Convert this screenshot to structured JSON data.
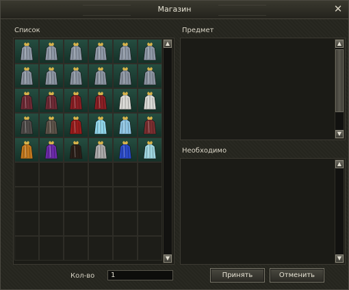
{
  "window": {
    "title": "Магазин",
    "close_glyph": "✕"
  },
  "list": {
    "label": "Список"
  },
  "item_panel": {
    "label": "Предмет"
  },
  "required_panel": {
    "label": "Необходимо"
  },
  "quantity": {
    "label": "Кол-во",
    "value": "1"
  },
  "buttons": {
    "accept": "Принять",
    "cancel": "Отменить"
  },
  "scroll_glyphs": {
    "up": "▲",
    "down": "▼"
  },
  "slots": [
    {
      "icon": "cloak-icon",
      "color": "#8e98a6"
    },
    {
      "icon": "cloak-icon",
      "color": "#8e98a6"
    },
    {
      "icon": "cloak-icon",
      "color": "#8e98a6"
    },
    {
      "icon": "cloak-icon",
      "color": "#8e98a6"
    },
    {
      "icon": "cloak-icon",
      "color": "#8e98a6"
    },
    {
      "icon": "cloak-icon",
      "color": "#8e98a6"
    },
    {
      "icon": "cloak-icon",
      "color": "#8a93a0"
    },
    {
      "icon": "cloak-icon",
      "color": "#8a93a0"
    },
    {
      "icon": "cloak-icon",
      "color": "#8a93a0"
    },
    {
      "icon": "cloak-icon",
      "color": "#8a93a0"
    },
    {
      "icon": "cloak-icon",
      "color": "#8a93a0"
    },
    {
      "icon": "cloak-icon",
      "color": "#8a93a0"
    },
    {
      "icon": "cloak-icon",
      "color": "#6e2a35"
    },
    {
      "icon": "cloak-icon",
      "color": "#6e2a35"
    },
    {
      "icon": "cloak-icon",
      "color": "#8a1f24"
    },
    {
      "icon": "cloak-icon",
      "color": "#8a1f24"
    },
    {
      "icon": "cloak-icon",
      "color": "#d8d8d4"
    },
    {
      "icon": "cloak-icon",
      "color": "#d8d8d4"
    },
    {
      "icon": "cloak-icon",
      "color": "#4e4a48"
    },
    {
      "icon": "cloak-icon",
      "color": "#5c5248"
    },
    {
      "icon": "cloak-icon",
      "color": "#9a1c1c"
    },
    {
      "icon": "cloak-icon",
      "color": "#8fd4e8"
    },
    {
      "icon": "cloak-icon",
      "color": "#8fc6e4"
    },
    {
      "icon": "cloak-icon",
      "color": "#7a2e30"
    },
    {
      "icon": "cloak-icon",
      "color": "#c2781e"
    },
    {
      "icon": "cloak-icon",
      "color": "#6a2aa8"
    },
    {
      "icon": "cloak-icon",
      "color": "#2a1e18"
    },
    {
      "icon": "cloak-icon",
      "color": "#a8a8a8"
    },
    {
      "icon": "cloak-icon",
      "color": "#2a4ac8"
    },
    {
      "icon": "cloak-icon",
      "color": "#9ed6e0"
    },
    null,
    null,
    null,
    null,
    null,
    null,
    null,
    null,
    null,
    null,
    null,
    null,
    null,
    null,
    null,
    null,
    null,
    null,
    null,
    null,
    null,
    null,
    null,
    null
  ]
}
